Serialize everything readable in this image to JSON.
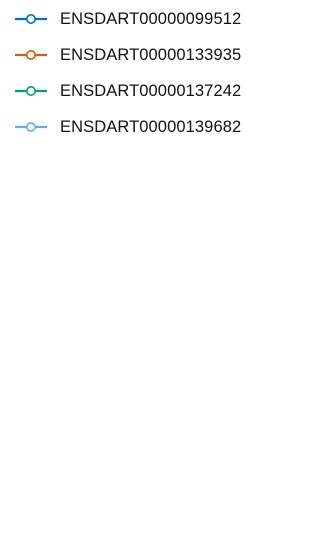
{
  "chart_data": {
    "type": "line",
    "legend_position": "top-left",
    "series": [
      {
        "name": "ENSDART00000099512",
        "color": "#0072B2",
        "marker": "circle-open",
        "values": []
      },
      {
        "name": "ENSDART00000133935",
        "color": "#D55E00",
        "marker": "circle-open",
        "values": []
      },
      {
        "name": "ENSDART00000137242",
        "color": "#009E73",
        "marker": "circle-open",
        "values": []
      },
      {
        "name": "ENSDART00000139682",
        "color": "#56B4E9",
        "marker": "circle-open",
        "values": []
      }
    ]
  }
}
